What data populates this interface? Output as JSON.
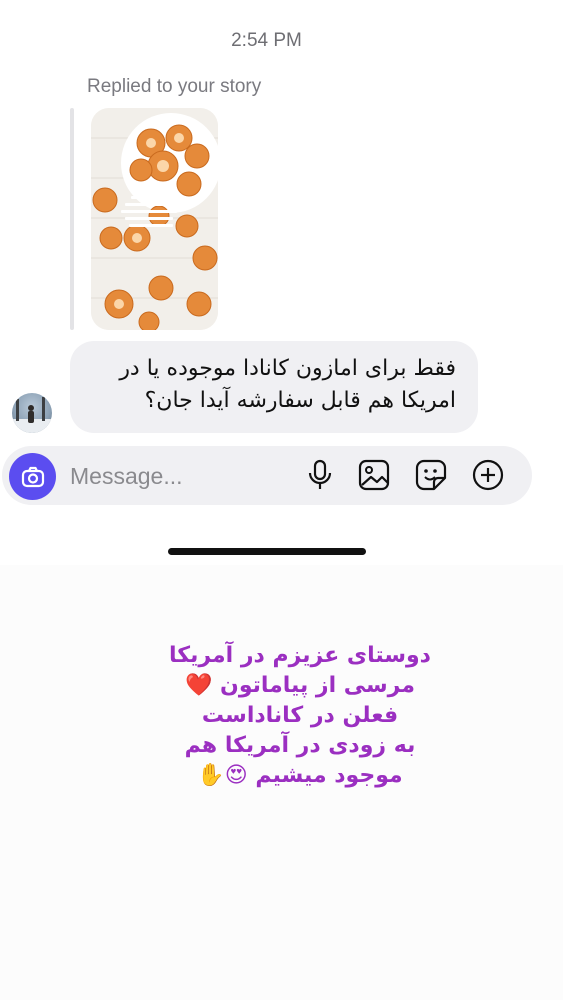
{
  "status_time": "2:54 PM",
  "reply": {
    "label": "Replied to your story",
    "story_caption": "فقط برای امازون کانادا موجوده یا در امریکا هم قابل سفارشه"
  },
  "message": {
    "text": "فقط برای امازون کانادا موجوده یا در امریکا هم قابل سفارشه آیدا جان؟"
  },
  "composer": {
    "placeholder": "Message...",
    "icons": [
      "camera-icon",
      "microphone-icon",
      "image-icon",
      "sticker-icon",
      "plus-icon"
    ],
    "accent_color": "#5b4df0"
  },
  "story_reply": {
    "lines": [
      "دوستای عزیزم در آمریکا",
      "مرسی از پیاماتون ❤️",
      "فعلن در کاناداست",
      "به زودی در آمریکا هم",
      "موجود میشیم 😍✋"
    ],
    "text_color": "#9b2fc1"
  }
}
